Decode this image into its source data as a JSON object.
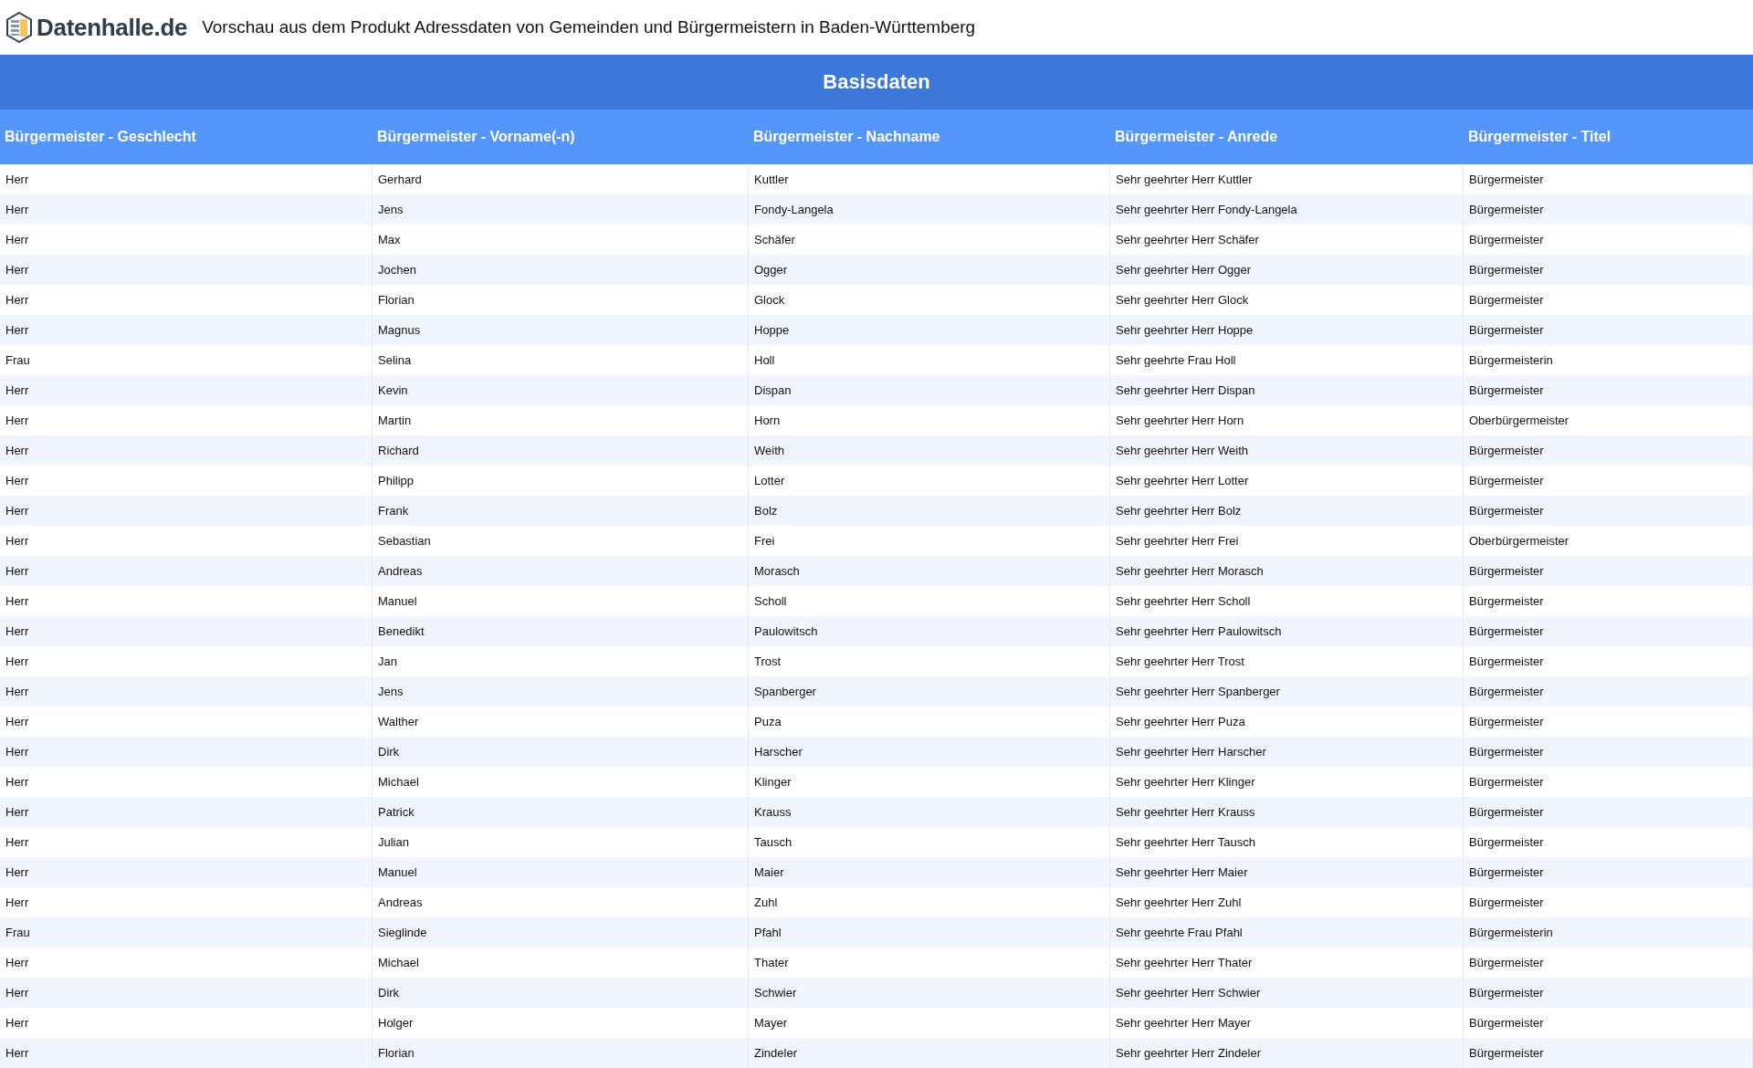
{
  "header": {
    "logo_text": "Datenhalle.de",
    "title": "Vorschau aus dem Produkt Adressdaten von Gemeinden und Bürgermeistern in Baden-Württemberg"
  },
  "table": {
    "caption": "Basisdaten",
    "columns": [
      "Bürgermeister - Geschlecht",
      "Bürgermeister - Vorname(-n)",
      "Bürgermeister - Nachname",
      "Bürgermeister - Anrede",
      "Bürgermeister - Titel"
    ],
    "rows": [
      [
        "Herr",
        "Gerhard",
        "Kuttler",
        "Sehr geehrter Herr Kuttler",
        "Bürgermeister"
      ],
      [
        "Herr",
        "Jens",
        "Fondy-Langela",
        "Sehr geehrter Herr Fondy-Langela",
        "Bürgermeister"
      ],
      [
        "Herr",
        "Max",
        "Schäfer",
        "Sehr geehrter Herr Schäfer",
        "Bürgermeister"
      ],
      [
        "Herr",
        "Jochen",
        "Ogger",
        "Sehr geehrter Herr Ogger",
        "Bürgermeister"
      ],
      [
        "Herr",
        "Florian",
        "Glock",
        "Sehr geehrter Herr Glock",
        "Bürgermeister"
      ],
      [
        "Herr",
        "Magnus",
        "Hoppe",
        "Sehr geehrter Herr Hoppe",
        "Bürgermeister"
      ],
      [
        "Frau",
        "Selina",
        "Holl",
        "Sehr geehrte Frau Holl",
        "Bürgermeisterin"
      ],
      [
        "Herr",
        "Kevin",
        "Dispan",
        "Sehr geehrter Herr Dispan",
        "Bürgermeister"
      ],
      [
        "Herr",
        "Martin",
        "Horn",
        "Sehr geehrter Herr Horn",
        "Oberbürgermeister"
      ],
      [
        "Herr",
        "Richard",
        "Weith",
        "Sehr geehrter Herr Weith",
        "Bürgermeister"
      ],
      [
        "Herr",
        "Philipp",
        "Lotter",
        "Sehr geehrter Herr Lotter",
        "Bürgermeister"
      ],
      [
        "Herr",
        "Frank",
        "Bolz",
        "Sehr geehrter Herr Bolz",
        "Bürgermeister"
      ],
      [
        "Herr",
        "Sebastian",
        "Frei",
        "Sehr geehrter Herr Frei",
        "Oberbürgermeister"
      ],
      [
        "Herr",
        "Andreas",
        "Morasch",
        "Sehr geehrter Herr Morasch",
        "Bürgermeister"
      ],
      [
        "Herr",
        "Manuel",
        "Scholl",
        "Sehr geehrter Herr Scholl",
        "Bürgermeister"
      ],
      [
        "Herr",
        "Benedikt",
        "Paulowitsch",
        "Sehr geehrter Herr Paulowitsch",
        "Bürgermeister"
      ],
      [
        "Herr",
        "Jan",
        "Trost",
        "Sehr geehrter Herr Trost",
        "Bürgermeister"
      ],
      [
        "Herr",
        "Jens",
        "Spanberger",
        "Sehr geehrter Herr Spanberger",
        "Bürgermeister"
      ],
      [
        "Herr",
        "Walther",
        "Puza",
        "Sehr geehrter Herr Puza",
        "Bürgermeister"
      ],
      [
        "Herr",
        "Dirk",
        "Harscher",
        "Sehr geehrter Herr Harscher",
        "Bürgermeister"
      ],
      [
        "Herr",
        "Michael",
        "Klinger",
        "Sehr geehrter Herr Klinger",
        "Bürgermeister"
      ],
      [
        "Herr",
        "Patrick",
        "Krauss",
        "Sehr geehrter Herr Krauss",
        "Bürgermeister"
      ],
      [
        "Herr",
        "Julian",
        "Tausch",
        "Sehr geehrter Herr Tausch",
        "Bürgermeister"
      ],
      [
        "Herr",
        "Manuel",
        "Maier",
        "Sehr geehrter Herr Maier",
        "Bürgermeister"
      ],
      [
        "Herr",
        "Andreas",
        "Zuhl",
        "Sehr geehrter Herr Zuhl",
        "Bürgermeister"
      ],
      [
        "Frau",
        "Sieglinde",
        "Pfahl",
        "Sehr geehrte Frau Pfahl",
        "Bürgermeisterin"
      ],
      [
        "Herr",
        "Michael",
        "Thater",
        "Sehr geehrter Herr Thater",
        "Bürgermeister"
      ],
      [
        "Herr",
        "Dirk",
        "Schwier",
        "Sehr geehrter Herr Schwier",
        "Bürgermeister"
      ],
      [
        "Herr",
        "Holger",
        "Mayer",
        "Sehr geehrter Herr Mayer",
        "Bürgermeister"
      ],
      [
        "Herr",
        "Florian",
        "Zindeler",
        "Sehr geehrter Herr Zindeler",
        "Bürgermeister"
      ]
    ]
  }
}
